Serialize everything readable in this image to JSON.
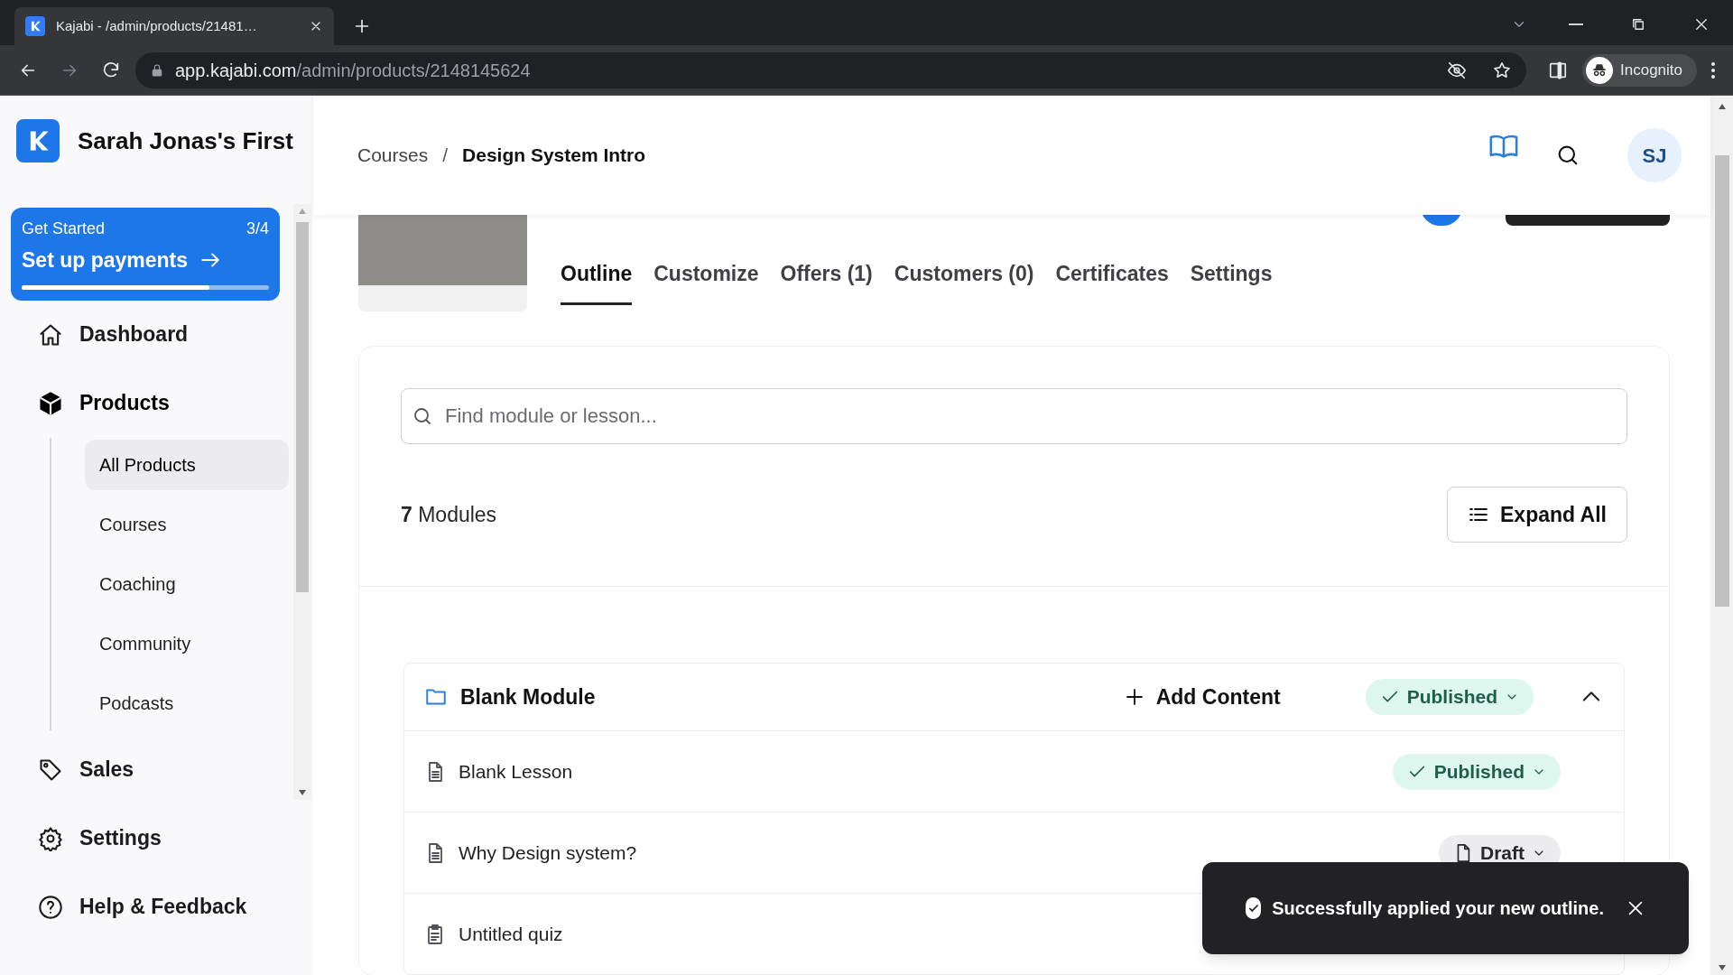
{
  "browser": {
    "tab_title": "Kajabi - /admin/products/21481…",
    "url_host": "app.kajabi.com",
    "url_path": "/admin/products/2148145624",
    "profile": "Incognito"
  },
  "sidebar": {
    "site_name": "Sarah Jonas's First",
    "get_started": {
      "label": "Get Started",
      "count": "3/4",
      "action": "Set up payments",
      "level": 0.76
    },
    "items": [
      {
        "label": "Dashboard",
        "expanded": false
      },
      {
        "label": "Products",
        "expanded": true,
        "children": [
          {
            "label": "All Products",
            "selected": true
          },
          {
            "label": "Courses",
            "selected": false
          },
          {
            "label": "Coaching",
            "selected": false
          },
          {
            "label": "Community",
            "selected": false
          },
          {
            "label": "Podcasts",
            "selected": false
          }
        ]
      },
      {
        "label": "Sales",
        "expanded": false
      },
      {
        "label": "Settings",
        "expanded": false
      },
      {
        "label": "Help & Feedback",
        "expanded": false
      }
    ]
  },
  "header": {
    "breadcrumbs": [
      "Courses",
      "Design System Intro"
    ],
    "separator": "/",
    "avatar": "SJ"
  },
  "tabs": [
    {
      "label": "Outline",
      "selected": true
    },
    {
      "label": "Customize",
      "selected": false
    },
    {
      "label": "Offers (1)",
      "selected": false
    },
    {
      "label": "Customers (0)",
      "selected": false
    },
    {
      "label": "Certificates",
      "selected": false
    },
    {
      "label": "Settings",
      "selected": false
    }
  ],
  "outline": {
    "search": {
      "placeholder": "Find module or lesson..."
    },
    "module_count": "7",
    "module_count_label": "Modules",
    "expand_all": "Expand All",
    "module": {
      "title": "Blank Module",
      "add_content": "Add Content",
      "status": "Published",
      "published": true,
      "expanded": true,
      "lessons": [
        {
          "kind": "lesson",
          "title": "Blank Lesson",
          "status": "Published",
          "published": true
        },
        {
          "kind": "lesson",
          "title": "Why Design system?",
          "status": "Draft",
          "published": false
        },
        {
          "kind": "quiz",
          "title": "Untitled quiz"
        }
      ]
    }
  },
  "toast": {
    "message": "Successfully applied your new outline."
  }
}
